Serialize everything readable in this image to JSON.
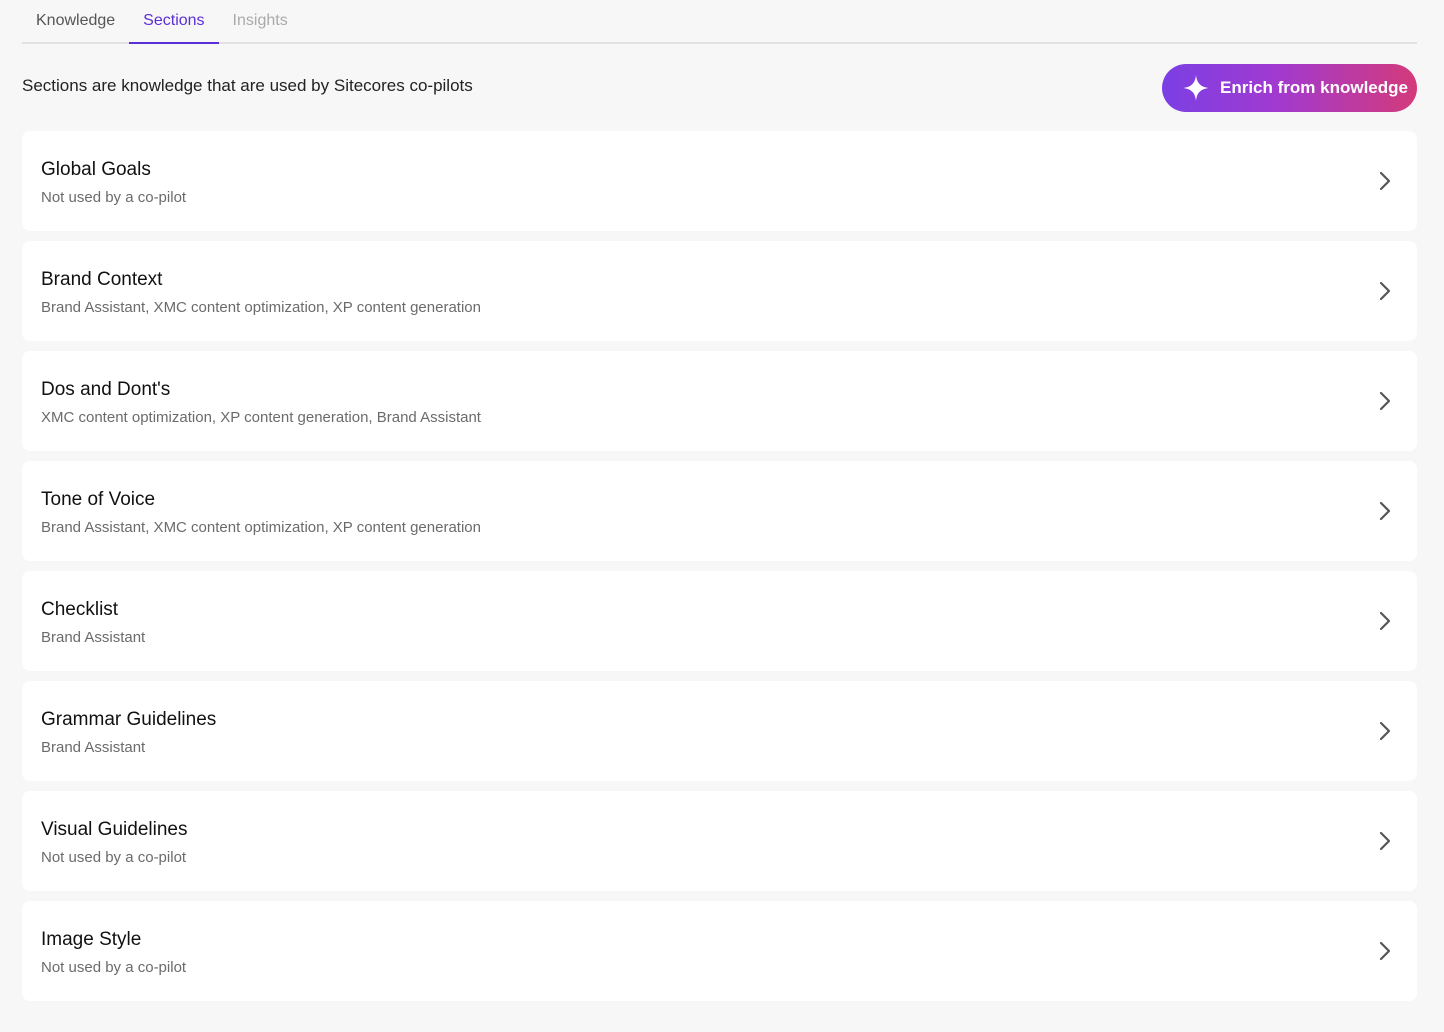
{
  "tabs": [
    {
      "label": "Knowledge"
    },
    {
      "label": "Sections"
    },
    {
      "label": "Insights"
    }
  ],
  "intro": "Sections are knowledge that are used by Sitecores co-pilots",
  "enrich_button": {
    "label": "Enrich from knowledge",
    "icon": "sparkle-icon"
  },
  "accent_color": "#5b2fd6",
  "sections": [
    {
      "title": "Global Goals",
      "subtitle": "Not used by a co-pilot"
    },
    {
      "title": "Brand Context",
      "subtitle": "Brand Assistant, XMC content optimization, XP content generation"
    },
    {
      "title": "Dos and Dont's",
      "subtitle": "XMC content optimization, XP content generation, Brand Assistant"
    },
    {
      "title": "Tone of Voice",
      "subtitle": "Brand Assistant, XMC content optimization, XP content generation"
    },
    {
      "title": "Checklist",
      "subtitle": "Brand Assistant"
    },
    {
      "title": "Grammar Guidelines",
      "subtitle": "Brand Assistant"
    },
    {
      "title": "Visual Guidelines",
      "subtitle": "Not used by a co-pilot"
    },
    {
      "title": "Image Style",
      "subtitle": "Not used by a co-pilot"
    }
  ]
}
